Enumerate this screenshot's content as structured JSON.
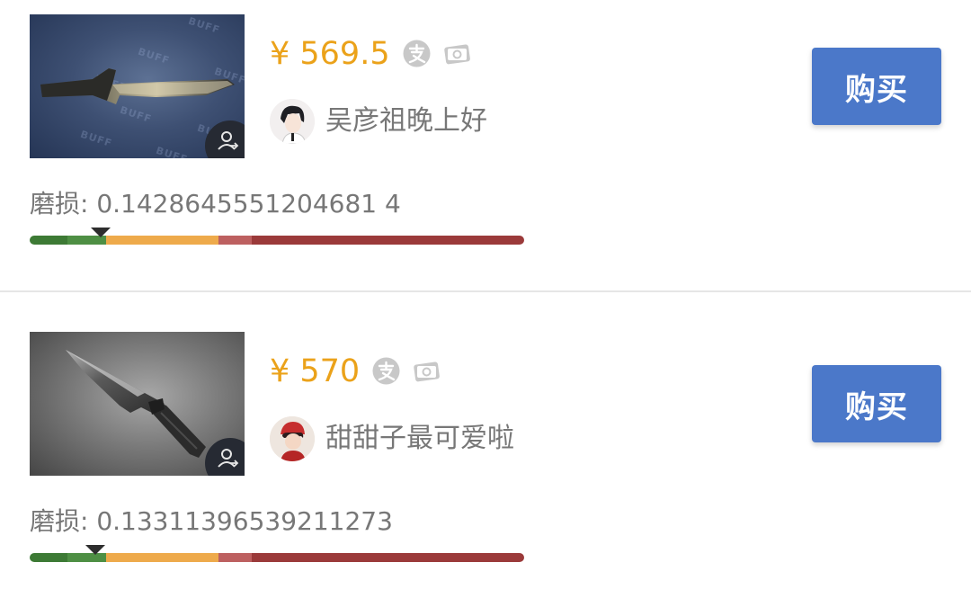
{
  "colors": {
    "price": "#eba21a",
    "buy_button": "#4b78c9",
    "wear_scale": [
      "#3d7a35",
      "#4e8f44",
      "#eeaa4b",
      "#bd6060",
      "#9b3a3a"
    ],
    "wear_marker": "#2d2d2d"
  },
  "listings": [
    {
      "thumbnail_icon": "knife-image-blue-background",
      "thumbnail_watermark": "BUFF",
      "price": "¥ 569.5",
      "payment_icons": [
        "alipay-icon",
        "card-payment-icon"
      ],
      "avatar_icon": "user-avatar",
      "seller": "吴彦祖晚上好",
      "wear_text": "磨损: 0.1428645551204681 4",
      "wear_value": 0.14286455512046814,
      "buy_label": "购买"
    },
    {
      "thumbnail_icon": "knife-image-grey-background",
      "thumbnail_watermark": "",
      "price": "¥ 570",
      "payment_icons": [
        "alipay-icon",
        "card-payment-icon"
      ],
      "avatar_icon": "user-avatar",
      "seller": "甜甜子最可爱啦",
      "wear_text": "磨损: 0.13311396539211273",
      "wear_value": 0.13311396539211273,
      "buy_label": "购买"
    }
  ]
}
